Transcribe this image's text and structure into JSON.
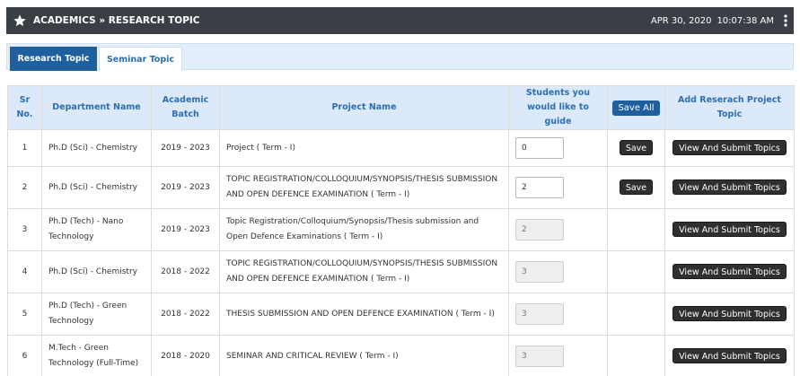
{
  "header": {
    "title": "ACADEMICS » RESEARCH TOPIC",
    "date": "APR 30, 2020",
    "time": "10:07:38 AM",
    "icons": {
      "left": "star-icon",
      "right": "more-vertical-icon"
    }
  },
  "tabs": [
    {
      "label": "Research Topic",
      "active": true
    },
    {
      "label": "Seminar Topic",
      "active": false
    }
  ],
  "table": {
    "headers": {
      "sr": "Sr No.",
      "department": "Department Name",
      "batch": "Academic Batch",
      "project": "Project Name",
      "students": "Students you would like to guide",
      "save_all": "Save All",
      "add": "Add Reserach Project Topic"
    },
    "rows": [
      {
        "sr": "1",
        "department": "Ph.D (Sci) - Chemistry",
        "batch": "2019 - 2023",
        "project": "Project ( Term - I)",
        "students": "0",
        "editable": true,
        "save": "Save",
        "action": "View And Submit Topics"
      },
      {
        "sr": "2",
        "department": "Ph.D (Sci) - Chemistry",
        "batch": "2019 - 2023",
        "project": "TOPIC REGISTRATION/COLLOQUIUM/SYNOPSIS/THESIS SUBMISSION AND OPEN DEFENCE EXAMINATION ( Term - I)",
        "students": "2",
        "editable": true,
        "save": "Save",
        "action": "View And Submit Topics"
      },
      {
        "sr": "3",
        "department": "Ph.D (Tech) - Nano Technology",
        "batch": "2019 - 2023",
        "project": "Topic Registration/Colloquium/Synopsis/Thesis submission and Open Defence Examinations ( Term - I)",
        "students": "2",
        "editable": false,
        "save": "",
        "action": "View And Submit Topics"
      },
      {
        "sr": "4",
        "department": "Ph.D (Sci) - Chemistry",
        "batch": "2018 - 2022",
        "project": "TOPIC REGISTRATION/COLLOQUIUM/SYNOPSIS/THESIS SUBMISSION AND OPEN DEFENCE EXAMINATION ( Term - I)",
        "students": "3",
        "editable": false,
        "save": "",
        "action": "View And Submit Topics"
      },
      {
        "sr": "5",
        "department": "Ph.D (Tech) - Green Technology",
        "batch": "2018 - 2022",
        "project": "THESIS SUBMISSION AND OPEN DEFENCE EXAMINATION ( Term - I)",
        "students": "3",
        "editable": false,
        "save": "",
        "action": "View And Submit Topics"
      },
      {
        "sr": "6",
        "department": "M.Tech - Green Technology (Full-Time)",
        "batch": "2018 - 2020",
        "project": "SEMINAR AND CRITICAL REVIEW ( Term - I)",
        "students": "3",
        "editable": false,
        "save": "",
        "action": "View And Submit Topics"
      }
    ]
  },
  "colors": {
    "header_bg": "#3a3f45",
    "accent": "#1f5f9e",
    "table_head_bg": "#dbe9fa",
    "tab_bar_bg": "#e3effb"
  }
}
